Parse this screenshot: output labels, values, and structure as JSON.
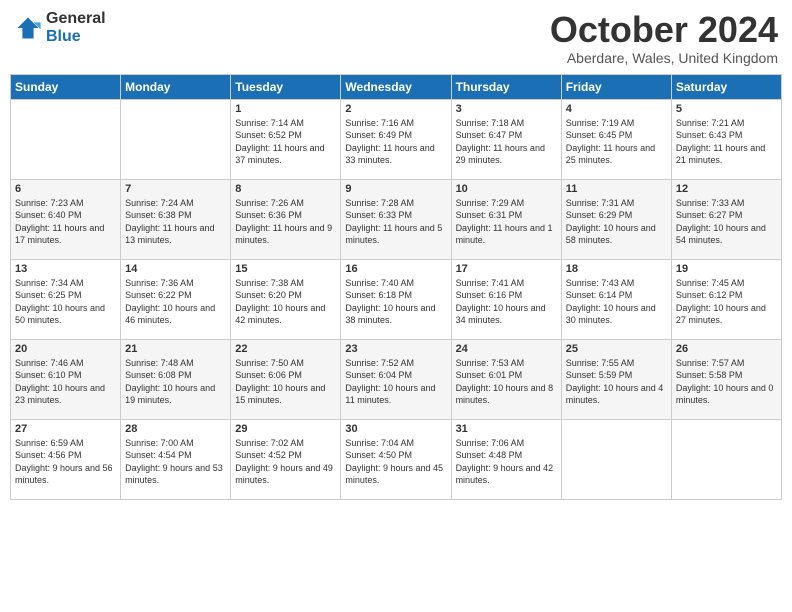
{
  "logo": {
    "general": "General",
    "blue": "Blue"
  },
  "title": {
    "month": "October 2024",
    "location": "Aberdare, Wales, United Kingdom"
  },
  "weekdays": [
    "Sunday",
    "Monday",
    "Tuesday",
    "Wednesday",
    "Thursday",
    "Friday",
    "Saturday"
  ],
  "weeks": [
    [
      {
        "day": "",
        "detail": ""
      },
      {
        "day": "",
        "detail": ""
      },
      {
        "day": "1",
        "detail": "Sunrise: 7:14 AM\nSunset: 6:52 PM\nDaylight: 11 hours and 37 minutes."
      },
      {
        "day": "2",
        "detail": "Sunrise: 7:16 AM\nSunset: 6:49 PM\nDaylight: 11 hours and 33 minutes."
      },
      {
        "day": "3",
        "detail": "Sunrise: 7:18 AM\nSunset: 6:47 PM\nDaylight: 11 hours and 29 minutes."
      },
      {
        "day": "4",
        "detail": "Sunrise: 7:19 AM\nSunset: 6:45 PM\nDaylight: 11 hours and 25 minutes."
      },
      {
        "day": "5",
        "detail": "Sunrise: 7:21 AM\nSunset: 6:43 PM\nDaylight: 11 hours and 21 minutes."
      }
    ],
    [
      {
        "day": "6",
        "detail": "Sunrise: 7:23 AM\nSunset: 6:40 PM\nDaylight: 11 hours and 17 minutes."
      },
      {
        "day": "7",
        "detail": "Sunrise: 7:24 AM\nSunset: 6:38 PM\nDaylight: 11 hours and 13 minutes."
      },
      {
        "day": "8",
        "detail": "Sunrise: 7:26 AM\nSunset: 6:36 PM\nDaylight: 11 hours and 9 minutes."
      },
      {
        "day": "9",
        "detail": "Sunrise: 7:28 AM\nSunset: 6:33 PM\nDaylight: 11 hours and 5 minutes."
      },
      {
        "day": "10",
        "detail": "Sunrise: 7:29 AM\nSunset: 6:31 PM\nDaylight: 11 hours and 1 minute."
      },
      {
        "day": "11",
        "detail": "Sunrise: 7:31 AM\nSunset: 6:29 PM\nDaylight: 10 hours and 58 minutes."
      },
      {
        "day": "12",
        "detail": "Sunrise: 7:33 AM\nSunset: 6:27 PM\nDaylight: 10 hours and 54 minutes."
      }
    ],
    [
      {
        "day": "13",
        "detail": "Sunrise: 7:34 AM\nSunset: 6:25 PM\nDaylight: 10 hours and 50 minutes."
      },
      {
        "day": "14",
        "detail": "Sunrise: 7:36 AM\nSunset: 6:22 PM\nDaylight: 10 hours and 46 minutes."
      },
      {
        "day": "15",
        "detail": "Sunrise: 7:38 AM\nSunset: 6:20 PM\nDaylight: 10 hours and 42 minutes."
      },
      {
        "day": "16",
        "detail": "Sunrise: 7:40 AM\nSunset: 6:18 PM\nDaylight: 10 hours and 38 minutes."
      },
      {
        "day": "17",
        "detail": "Sunrise: 7:41 AM\nSunset: 6:16 PM\nDaylight: 10 hours and 34 minutes."
      },
      {
        "day": "18",
        "detail": "Sunrise: 7:43 AM\nSunset: 6:14 PM\nDaylight: 10 hours and 30 minutes."
      },
      {
        "day": "19",
        "detail": "Sunrise: 7:45 AM\nSunset: 6:12 PM\nDaylight: 10 hours and 27 minutes."
      }
    ],
    [
      {
        "day": "20",
        "detail": "Sunrise: 7:46 AM\nSunset: 6:10 PM\nDaylight: 10 hours and 23 minutes."
      },
      {
        "day": "21",
        "detail": "Sunrise: 7:48 AM\nSunset: 6:08 PM\nDaylight: 10 hours and 19 minutes."
      },
      {
        "day": "22",
        "detail": "Sunrise: 7:50 AM\nSunset: 6:06 PM\nDaylight: 10 hours and 15 minutes."
      },
      {
        "day": "23",
        "detail": "Sunrise: 7:52 AM\nSunset: 6:04 PM\nDaylight: 10 hours and 11 minutes."
      },
      {
        "day": "24",
        "detail": "Sunrise: 7:53 AM\nSunset: 6:01 PM\nDaylight: 10 hours and 8 minutes."
      },
      {
        "day": "25",
        "detail": "Sunrise: 7:55 AM\nSunset: 5:59 PM\nDaylight: 10 hours and 4 minutes."
      },
      {
        "day": "26",
        "detail": "Sunrise: 7:57 AM\nSunset: 5:58 PM\nDaylight: 10 hours and 0 minutes."
      }
    ],
    [
      {
        "day": "27",
        "detail": "Sunrise: 6:59 AM\nSunset: 4:56 PM\nDaylight: 9 hours and 56 minutes."
      },
      {
        "day": "28",
        "detail": "Sunrise: 7:00 AM\nSunset: 4:54 PM\nDaylight: 9 hours and 53 minutes."
      },
      {
        "day": "29",
        "detail": "Sunrise: 7:02 AM\nSunset: 4:52 PM\nDaylight: 9 hours and 49 minutes."
      },
      {
        "day": "30",
        "detail": "Sunrise: 7:04 AM\nSunset: 4:50 PM\nDaylight: 9 hours and 45 minutes."
      },
      {
        "day": "31",
        "detail": "Sunrise: 7:06 AM\nSunset: 4:48 PM\nDaylight: 9 hours and 42 minutes."
      },
      {
        "day": "",
        "detail": ""
      },
      {
        "day": "",
        "detail": ""
      }
    ]
  ]
}
